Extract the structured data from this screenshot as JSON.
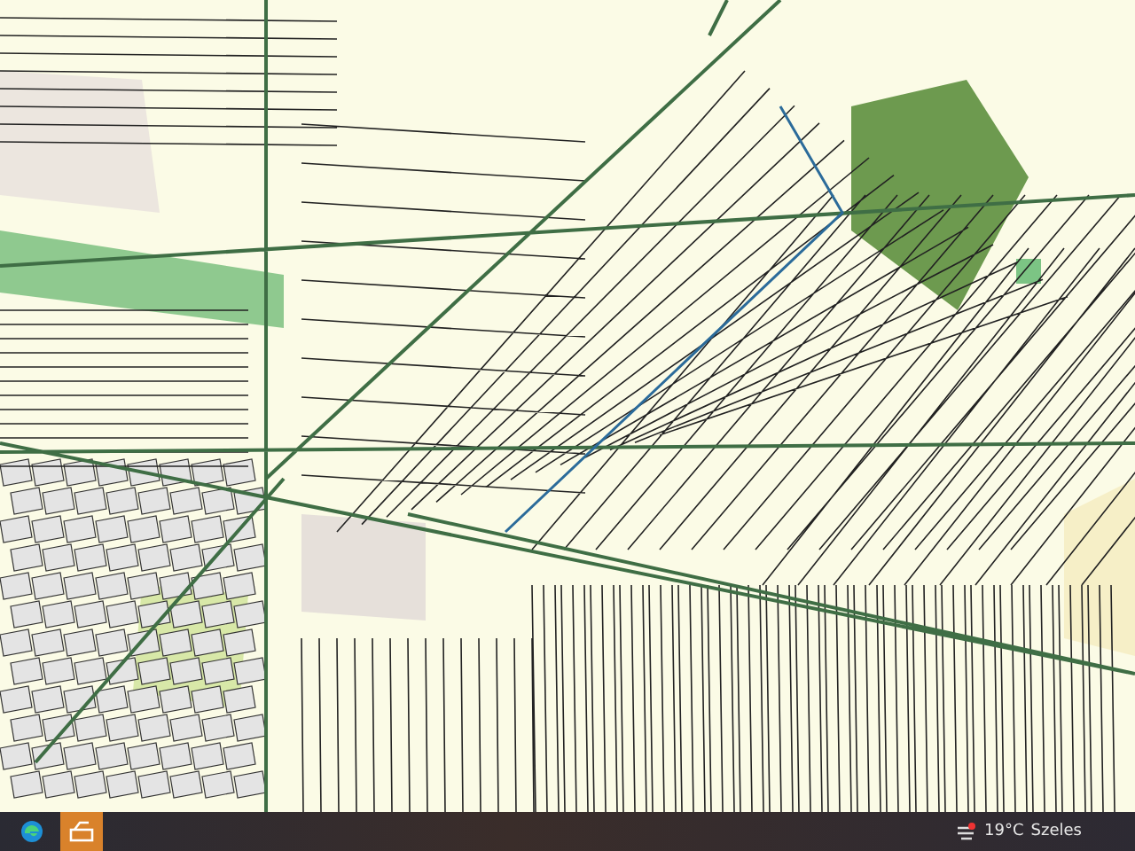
{
  "taskbar": {
    "apps": [
      {
        "kind": "browser",
        "selected": false
      },
      {
        "kind": "scanner",
        "selected": true
      }
    ],
    "weather": {
      "temperature": "19°C",
      "condition": "Szeles"
    }
  }
}
